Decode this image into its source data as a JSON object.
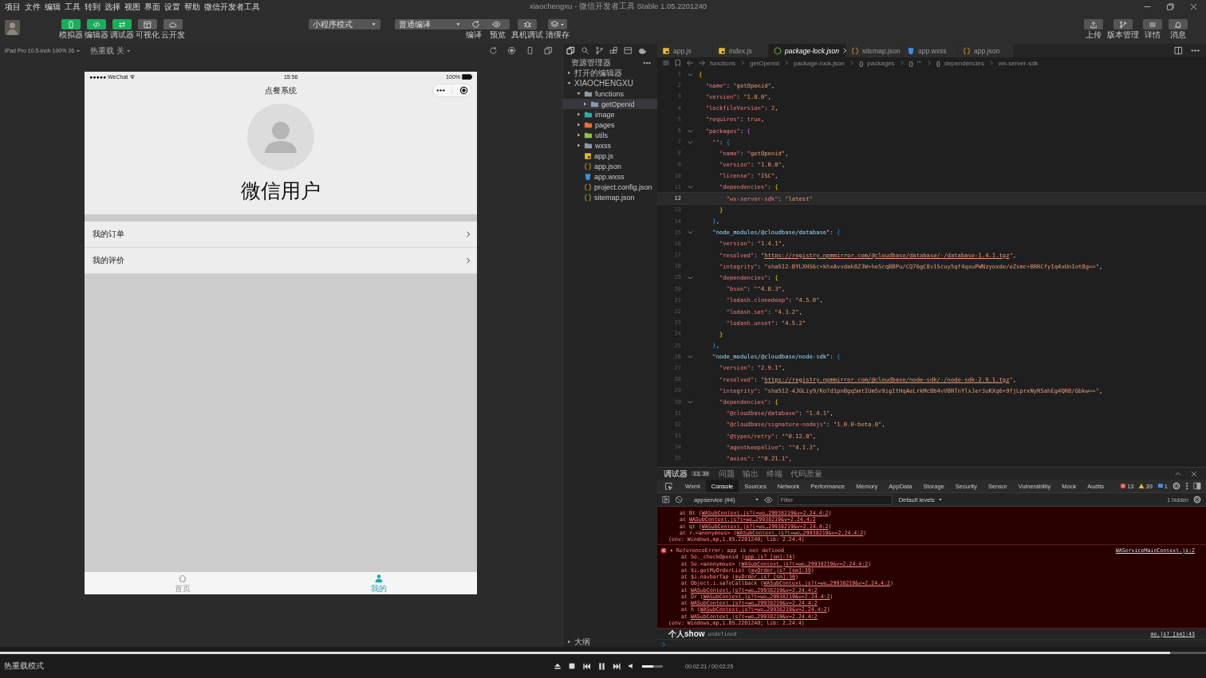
{
  "menu": [
    "项目",
    "文件",
    "编辑",
    "工具",
    "转到",
    "选择",
    "视图",
    "界面",
    "设置",
    "帮助",
    "微信开发者工具"
  ],
  "window": {
    "title": "xiaochengxu - 微信开发者工具 Stable 1.05.2201240"
  },
  "toolbar": {
    "views": [
      {
        "label": "模拟器",
        "selected": true
      },
      {
        "label": "编辑器",
        "selected": true
      },
      {
        "label": "调试器",
        "selected": true
      },
      {
        "label": "可视化",
        "selected": false
      },
      {
        "label": "云开发",
        "selected": false
      }
    ],
    "mode": "小程序模式",
    "compile": "普通编译",
    "actions": [
      "编译",
      "预览"
    ],
    "device_debug": "真机调试",
    "cache": "清缓存",
    "right": [
      "上传",
      "版本管理",
      "详情",
      "消息"
    ]
  },
  "simulator": {
    "device": "iPad Pro 10.5-inch 100% 26",
    "hot_reload": "热重载 关",
    "phone": {
      "carrier": "●●●●● WeChat",
      "time": "15:56",
      "battery": "100%",
      "nav_title": "点餐系统",
      "user_name": "微信用户",
      "menu": [
        {
          "label": "我的订单"
        },
        {
          "label": "我的评价"
        }
      ],
      "tabs": [
        {
          "label": "首页",
          "selected": false
        },
        {
          "label": "我的",
          "selected": true
        }
      ]
    }
  },
  "explorer": {
    "title": "资源管理器",
    "open_editors": "打开的编辑器",
    "outline": "大纲",
    "root": {
      "label": "XIAOCHENGXU",
      "expanded": true,
      "children": [
        {
          "label": "functions",
          "kind": "folder",
          "color": "#8a9aa6",
          "expanded": true,
          "selected": false,
          "children": [
            {
              "label": "getOpenid",
              "kind": "folder",
              "color": "#8a9aa6",
              "expanded": false,
              "selected": true
            }
          ]
        },
        {
          "label": "image",
          "kind": "folder",
          "color": "#2ab0a0",
          "expanded": false,
          "selected": false
        },
        {
          "label": "pages",
          "kind": "folder",
          "color": "#e8703a",
          "expanded": false,
          "selected": false
        },
        {
          "label": "utils",
          "kind": "folder",
          "color": "#8bc34a",
          "expanded": false,
          "selected": false
        },
        {
          "label": "wxss",
          "kind": "folder",
          "color": "#8a9aa6",
          "expanded": false,
          "selected": false
        },
        {
          "label": "app.js",
          "kind": "js",
          "selected": false
        },
        {
          "label": "app.json",
          "kind": "json",
          "selected": false
        },
        {
          "label": "app.wxss",
          "kind": "wxss",
          "selected": false
        },
        {
          "label": "project.config.json",
          "kind": "json",
          "selected": false
        },
        {
          "label": "sitemap.json",
          "kind": "json",
          "selected": false
        }
      ]
    }
  },
  "editor": {
    "tabs": [
      {
        "label": "app.js",
        "kind": "js",
        "selected": false
      },
      {
        "label": "index.js",
        "kind": "js",
        "selected": false
      },
      {
        "label": "package-lock.json",
        "kind": "node",
        "selected": true
      },
      {
        "label": "sitemap.json",
        "kind": "json",
        "selected": false
      },
      {
        "label": "app.wxss",
        "kind": "wxss",
        "selected": false
      },
      {
        "label": "app.json",
        "kind": "json",
        "selected": false
      }
    ],
    "breadcrumb": [
      {
        "label": "functions"
      },
      {
        "label": "getOpenid"
      },
      {
        "label": "package-lock.json"
      },
      {
        "glyph": "{}",
        "label": "packages"
      },
      {
        "glyph": "{}",
        "label": "\"\""
      },
      {
        "glyph": "{}",
        "label": "dependencies"
      },
      {
        "label": "wx-server-sdk"
      }
    ],
    "lines": [
      {
        "n": "1",
        "fold": true,
        "current": false,
        "code": [
          {
            "kind": "b1",
            "text": "{"
          }
        ]
      },
      {
        "n": "2",
        "fold": false,
        "current": false,
        "code": [
          {
            "kind": "key",
            "text": "  \"name\""
          },
          {
            "kind": "punct",
            "text": ": "
          },
          {
            "kind": "str",
            "text": "\"getOpenid\""
          },
          {
            "kind": "punct",
            "text": ","
          }
        ]
      },
      {
        "n": "3",
        "fold": false,
        "current": false,
        "code": [
          {
            "kind": "key",
            "text": "  \"version\""
          },
          {
            "kind": "punct",
            "text": ": "
          },
          {
            "kind": "str",
            "text": "\"1.0.0\""
          },
          {
            "kind": "punct",
            "text": ","
          }
        ]
      },
      {
        "n": "4",
        "fold": false,
        "current": false,
        "code": [
          {
            "kind": "key",
            "text": "  \"lockfileVersion\""
          },
          {
            "kind": "punct",
            "text": ": "
          },
          {
            "kind": "val",
            "text": "2"
          },
          {
            "kind": "punct",
            "text": ","
          }
        ]
      },
      {
        "n": "5",
        "fold": false,
        "current": false,
        "code": [
          {
            "kind": "key",
            "text": "  \"requires\""
          },
          {
            "kind": "punct",
            "text": ": "
          },
          {
            "kind": "val",
            "text": "true"
          },
          {
            "kind": "punct",
            "text": ","
          }
        ]
      },
      {
        "n": "6",
        "fold": true,
        "current": false,
        "code": [
          {
            "kind": "key",
            "text": "  \"packages\""
          },
          {
            "kind": "punct",
            "text": ": "
          },
          {
            "kind": "b2",
            "text": "{"
          }
        ]
      },
      {
        "n": "7",
        "fold": true,
        "current": false,
        "code": [
          {
            "kind": "key",
            "text": "    \"\""
          },
          {
            "kind": "punct",
            "text": ": "
          },
          {
            "kind": "b3",
            "text": "{"
          }
        ]
      },
      {
        "n": "8",
        "fold": false,
        "current": false,
        "code": [
          {
            "kind": "key",
            "text": "      \"name\""
          },
          {
            "kind": "punct",
            "text": ": "
          },
          {
            "kind": "str",
            "text": "\"getOpenid\""
          },
          {
            "kind": "punct",
            "text": ","
          }
        ]
      },
      {
        "n": "9",
        "fold": false,
        "current": false,
        "code": [
          {
            "kind": "key",
            "text": "      \"version\""
          },
          {
            "kind": "punct",
            "text": ": "
          },
          {
            "kind": "str",
            "text": "\"1.0.0\""
          },
          {
            "kind": "punct",
            "text": ","
          }
        ]
      },
      {
        "n": "10",
        "fold": false,
        "current": false,
        "code": [
          {
            "kind": "key",
            "text": "      \"license\""
          },
          {
            "kind": "punct",
            "text": ": "
          },
          {
            "kind": "str",
            "text": "\"ISC\""
          },
          {
            "kind": "punct",
            "text": ","
          }
        ]
      },
      {
        "n": "11",
        "fold": true,
        "current": false,
        "code": [
          {
            "kind": "key",
            "text": "      \"dependencies\""
          },
          {
            "kind": "punct",
            "text": ": "
          },
          {
            "kind": "b1",
            "text": "{"
          }
        ]
      },
      {
        "n": "12",
        "fold": false,
        "current": true,
        "code": [
          {
            "kind": "key",
            "text": "        \"wx-server-sdk\""
          },
          {
            "kind": "punct",
            "text": ": "
          },
          {
            "kind": "str",
            "text": "\"latest\""
          }
        ]
      },
      {
        "n": "13",
        "fold": false,
        "current": false,
        "code": [
          {
            "kind": "b1",
            "text": "      }"
          }
        ]
      },
      {
        "n": "14",
        "fold": false,
        "current": false,
        "code": [
          {
            "kind": "b3",
            "text": "    }"
          },
          {
            "kind": "punct",
            "text": ","
          }
        ]
      },
      {
        "n": "15",
        "fold": true,
        "current": false,
        "code": [
          {
            "kind": "mod",
            "text": "    \"node_modules/@cloudbase/database\""
          },
          {
            "kind": "punct",
            "text": ": "
          },
          {
            "kind": "b3",
            "text": "{"
          }
        ]
      },
      {
        "n": "16",
        "fold": false,
        "current": false,
        "code": [
          {
            "kind": "key",
            "text": "      \"version\""
          },
          {
            "kind": "punct",
            "text": ": "
          },
          {
            "kind": "str",
            "text": "\"1.4.1\""
          },
          {
            "kind": "punct",
            "text": ","
          }
        ]
      },
      {
        "n": "17",
        "fold": false,
        "current": false,
        "code": [
          {
            "kind": "key",
            "text": "      \"resolved\""
          },
          {
            "kind": "punct",
            "text": ": "
          },
          {
            "kind": "str",
            "text": "\""
          },
          {
            "kind": "url",
            "text": "https://registry.npmmirror.com/@cloudbase/database/-/database-1.4.1.tgz"
          },
          {
            "kind": "str",
            "text": "\""
          },
          {
            "kind": "punct",
            "text": ","
          }
        ]
      },
      {
        "n": "18",
        "fold": false,
        "current": false,
        "code": [
          {
            "kind": "key",
            "text": "      \"integrity\""
          },
          {
            "kind": "punct",
            "text": ": "
          },
          {
            "kind": "str",
            "text": "\"sha512-BYLXHS6c+khxAvvdak8Z3W+heScqBBPu/CQ76gC8v1Scuy5qf4qxuPWNzyoxde/eZsmc+BRRCfyIq4xUnIot8g==\""
          },
          {
            "kind": "punct",
            "text": ","
          }
        ]
      },
      {
        "n": "19",
        "fold": true,
        "current": false,
        "code": [
          {
            "kind": "key",
            "text": "      \"dependencies\""
          },
          {
            "kind": "punct",
            "text": ": "
          },
          {
            "kind": "b1",
            "text": "{"
          }
        ]
      },
      {
        "n": "20",
        "fold": false,
        "current": false,
        "code": [
          {
            "kind": "key",
            "text": "        \"bson\""
          },
          {
            "kind": "punct",
            "text": ": "
          },
          {
            "kind": "str",
            "text": "\"^4.0.3\""
          },
          {
            "kind": "punct",
            "text": ","
          }
        ]
      },
      {
        "n": "21",
        "fold": false,
        "current": false,
        "code": [
          {
            "kind": "key",
            "text": "        \"lodash.clonedeep\""
          },
          {
            "kind": "punct",
            "text": ": "
          },
          {
            "kind": "str",
            "text": "\"4.5.0\""
          },
          {
            "kind": "punct",
            "text": ","
          }
        ]
      },
      {
        "n": "22",
        "fold": false,
        "current": false,
        "code": [
          {
            "kind": "key",
            "text": "        \"lodash.set\""
          },
          {
            "kind": "punct",
            "text": ": "
          },
          {
            "kind": "str",
            "text": "\"4.3.2\""
          },
          {
            "kind": "punct",
            "text": ","
          }
        ]
      },
      {
        "n": "23",
        "fold": false,
        "current": false,
        "code": [
          {
            "kind": "key",
            "text": "        \"lodash.unset\""
          },
          {
            "kind": "punct",
            "text": ": "
          },
          {
            "kind": "str",
            "text": "\"4.5.2\""
          }
        ]
      },
      {
        "n": "24",
        "fold": false,
        "current": false,
        "code": [
          {
            "kind": "b1",
            "text": "      }"
          }
        ]
      },
      {
        "n": "25",
        "fold": false,
        "current": false,
        "code": [
          {
            "kind": "b3",
            "text": "    }"
          },
          {
            "kind": "punct",
            "text": ","
          }
        ]
      },
      {
        "n": "26",
        "fold": true,
        "current": false,
        "code": [
          {
            "kind": "mod",
            "text": "    \"node_modules/@cloudbase/node-sdk\""
          },
          {
            "kind": "punct",
            "text": ": "
          },
          {
            "kind": "b3",
            "text": "{"
          }
        ]
      },
      {
        "n": "27",
        "fold": false,
        "current": false,
        "code": [
          {
            "kind": "key",
            "text": "      \"version\""
          },
          {
            "kind": "punct",
            "text": ": "
          },
          {
            "kind": "str",
            "text": "\"2.9.1\""
          },
          {
            "kind": "punct",
            "text": ","
          }
        ]
      },
      {
        "n": "28",
        "fold": false,
        "current": false,
        "code": [
          {
            "kind": "key",
            "text": "      \"resolved\""
          },
          {
            "kind": "punct",
            "text": ": "
          },
          {
            "kind": "str",
            "text": "\""
          },
          {
            "kind": "url",
            "text": "https://registry.npmmirror.com/@cloudbase/node-sdk/-/node-sdk-2.9.1.tgz"
          },
          {
            "kind": "str",
            "text": "\""
          },
          {
            "kind": "punct",
            "text": ","
          }
        ]
      },
      {
        "n": "29",
        "fold": false,
        "current": false,
        "code": [
          {
            "kind": "key",
            "text": "      \"integrity\""
          },
          {
            "kind": "punct",
            "text": ": "
          },
          {
            "kind": "str",
            "text": "\"sha512-4JGLiy9/Ko7d1pnBgqSmtIUm5v9ig1tHqAeLrkMcBb4vVBRTnYlxJer3uKXq6+9fjLprxNyRSahEg4QRB/Gbkw==\""
          },
          {
            "kind": "punct",
            "text": ","
          }
        ]
      },
      {
        "n": "30",
        "fold": true,
        "current": false,
        "code": [
          {
            "kind": "key",
            "text": "      \"dependencies\""
          },
          {
            "kind": "punct",
            "text": ": "
          },
          {
            "kind": "b1",
            "text": "{"
          }
        ]
      },
      {
        "n": "31",
        "fold": false,
        "current": false,
        "code": [
          {
            "kind": "key",
            "text": "        \"@cloudbase/database\""
          },
          {
            "kind": "punct",
            "text": ": "
          },
          {
            "kind": "str",
            "text": "\"1.4.1\""
          },
          {
            "kind": "punct",
            "text": ","
          }
        ]
      },
      {
        "n": "32",
        "fold": false,
        "current": false,
        "code": [
          {
            "kind": "key",
            "text": "        \"@cloudbase/signature-nodejs\""
          },
          {
            "kind": "punct",
            "text": ": "
          },
          {
            "kind": "str",
            "text": "\"1.0.0-beta.0\""
          },
          {
            "kind": "punct",
            "text": ","
          }
        ]
      },
      {
        "n": "33",
        "fold": false,
        "current": false,
        "code": [
          {
            "kind": "key",
            "text": "        \"@types/retry\""
          },
          {
            "kind": "punct",
            "text": ": "
          },
          {
            "kind": "str",
            "text": "\"^0.12.0\""
          },
          {
            "kind": "punct",
            "text": ","
          }
        ]
      },
      {
        "n": "34",
        "fold": false,
        "current": false,
        "code": [
          {
            "kind": "key",
            "text": "        \"agentkeepalive\""
          },
          {
            "kind": "punct",
            "text": ": "
          },
          {
            "kind": "str",
            "text": "\"^4.1.3\""
          },
          {
            "kind": "punct",
            "text": ","
          }
        ]
      },
      {
        "n": "35",
        "fold": false,
        "current": false,
        "code": [
          {
            "kind": "key",
            "text": "        \"axios\""
          },
          {
            "kind": "punct",
            "text": ": "
          },
          {
            "kind": "str",
            "text": "\"^0.21.1\""
          },
          {
            "kind": "punct",
            "text": ","
          }
        ]
      }
    ]
  },
  "debugger": {
    "panels": [
      {
        "label": "调试器",
        "badge": "13, 39",
        "selected": true
      },
      {
        "label": "问题",
        "selected": false
      },
      {
        "label": "输出",
        "selected": false
      },
      {
        "label": "终端",
        "selected": false
      },
      {
        "label": "代码质量",
        "selected": false
      }
    ],
    "tabs": [
      {
        "label": "Wxml",
        "selected": false
      },
      {
        "label": "Console",
        "selected": true
      },
      {
        "label": "Sources",
        "selected": false
      },
      {
        "label": "Network",
        "selected": false
      },
      {
        "label": "Performance",
        "selected": false
      },
      {
        "label": "Memory",
        "selected": false
      },
      {
        "label": "AppData",
        "selected": false
      },
      {
        "label": "Storage",
        "selected": false
      },
      {
        "label": "Security",
        "selected": false
      },
      {
        "label": "Sensor",
        "selected": false
      },
      {
        "label": "Vulnerability",
        "selected": false
      },
      {
        "label": "Mock",
        "selected": false
      },
      {
        "label": "Audits",
        "selected": false
      }
    ],
    "errors": "13",
    "warnings": "39",
    "infos": "1",
    "context": "appservice (#4)",
    "filter": {
      "placeholder": "Filter"
    },
    "levels": "Default levels",
    "hidden": "1 hidden",
    "messages": [
      {
        "kind": "error",
        "frames": [
          {
            "pre": "at Bt (",
            "link": "WASubContext.js?t=we…29938219&v=2.24.4:2",
            "post": ")"
          },
          {
            "pre": "at ",
            "link": "WASubContext.js?t=we…29938219&v=2.24.4:2"
          },
          {
            "pre": "at qt (",
            "link": "WASubContext.js?t=we…29938219&v=2.24.4:2",
            "post": ")"
          },
          {
            "pre": "at r.<anonymous> (",
            "link": "WASubContext.js?t=we…29938219&v=2.24.4:2",
            "post": ")"
          }
        ],
        "env": "(env: Windows,mp,1.05.2201240; lib: 2.24.4)"
      },
      {
        "kind": "error",
        "text": "ReferenceError: app is not defined",
        "source": "WAServiceMainContext.js:2",
        "frames": [
          {
            "pre": "at Se._checkOpenid (",
            "link": "app.js? [sm]:74",
            "post": ")"
          },
          {
            "pre": "at Se.<anonymous> (",
            "link": "WASubContext.js?t=we…29938219&v=2.24.4:2",
            "post": ")"
          },
          {
            "pre": "at $i.getMyOrderList (",
            "link": "myOrder.js? [sm]:39",
            "post": ")"
          },
          {
            "pre": "at $i.navbarTap (",
            "link": "myOrder.js? [sm]:30",
            "post": ")"
          },
          {
            "pre": "at Object.i.safeCallback (",
            "link": "WASubContext.js?t=we…29938219&v=2.24.4:2",
            "post": ")"
          },
          {
            "pre": "at ",
            "link": "WASubContext.js?t=we…29938219&v=2.24.4:2"
          },
          {
            "pre": "at Or (",
            "link": "WASubContext.js?t=we…29938219&v=2.24.4:2",
            "post": ")"
          },
          {
            "pre": "at ",
            "link": "WASubContext.js?t=we…29938219&v=2.24.4:2"
          },
          {
            "pre": "at h (",
            "link": "WASubContext.js?t=we…29938219&v=2.24.4:2",
            "post": ")"
          },
          {
            "pre": "at ",
            "link": "WASubContext.js?t=we…29938219&v=2.24.4:2"
          }
        ],
        "env": "(env: Windows,mp,1.05.2201240; lib: 2.24.4)"
      },
      {
        "kind": "log",
        "label": "个人show",
        "value": "undefined",
        "source": "me.js? [sm]:43"
      }
    ]
  },
  "status": {
    "mode": "热重载模式"
  },
  "player": {
    "progress": {
      "level": 0.97
    },
    "volume": {
      "level": 0.55
    },
    "time": "00:02:21 / 00:02:25"
  }
}
